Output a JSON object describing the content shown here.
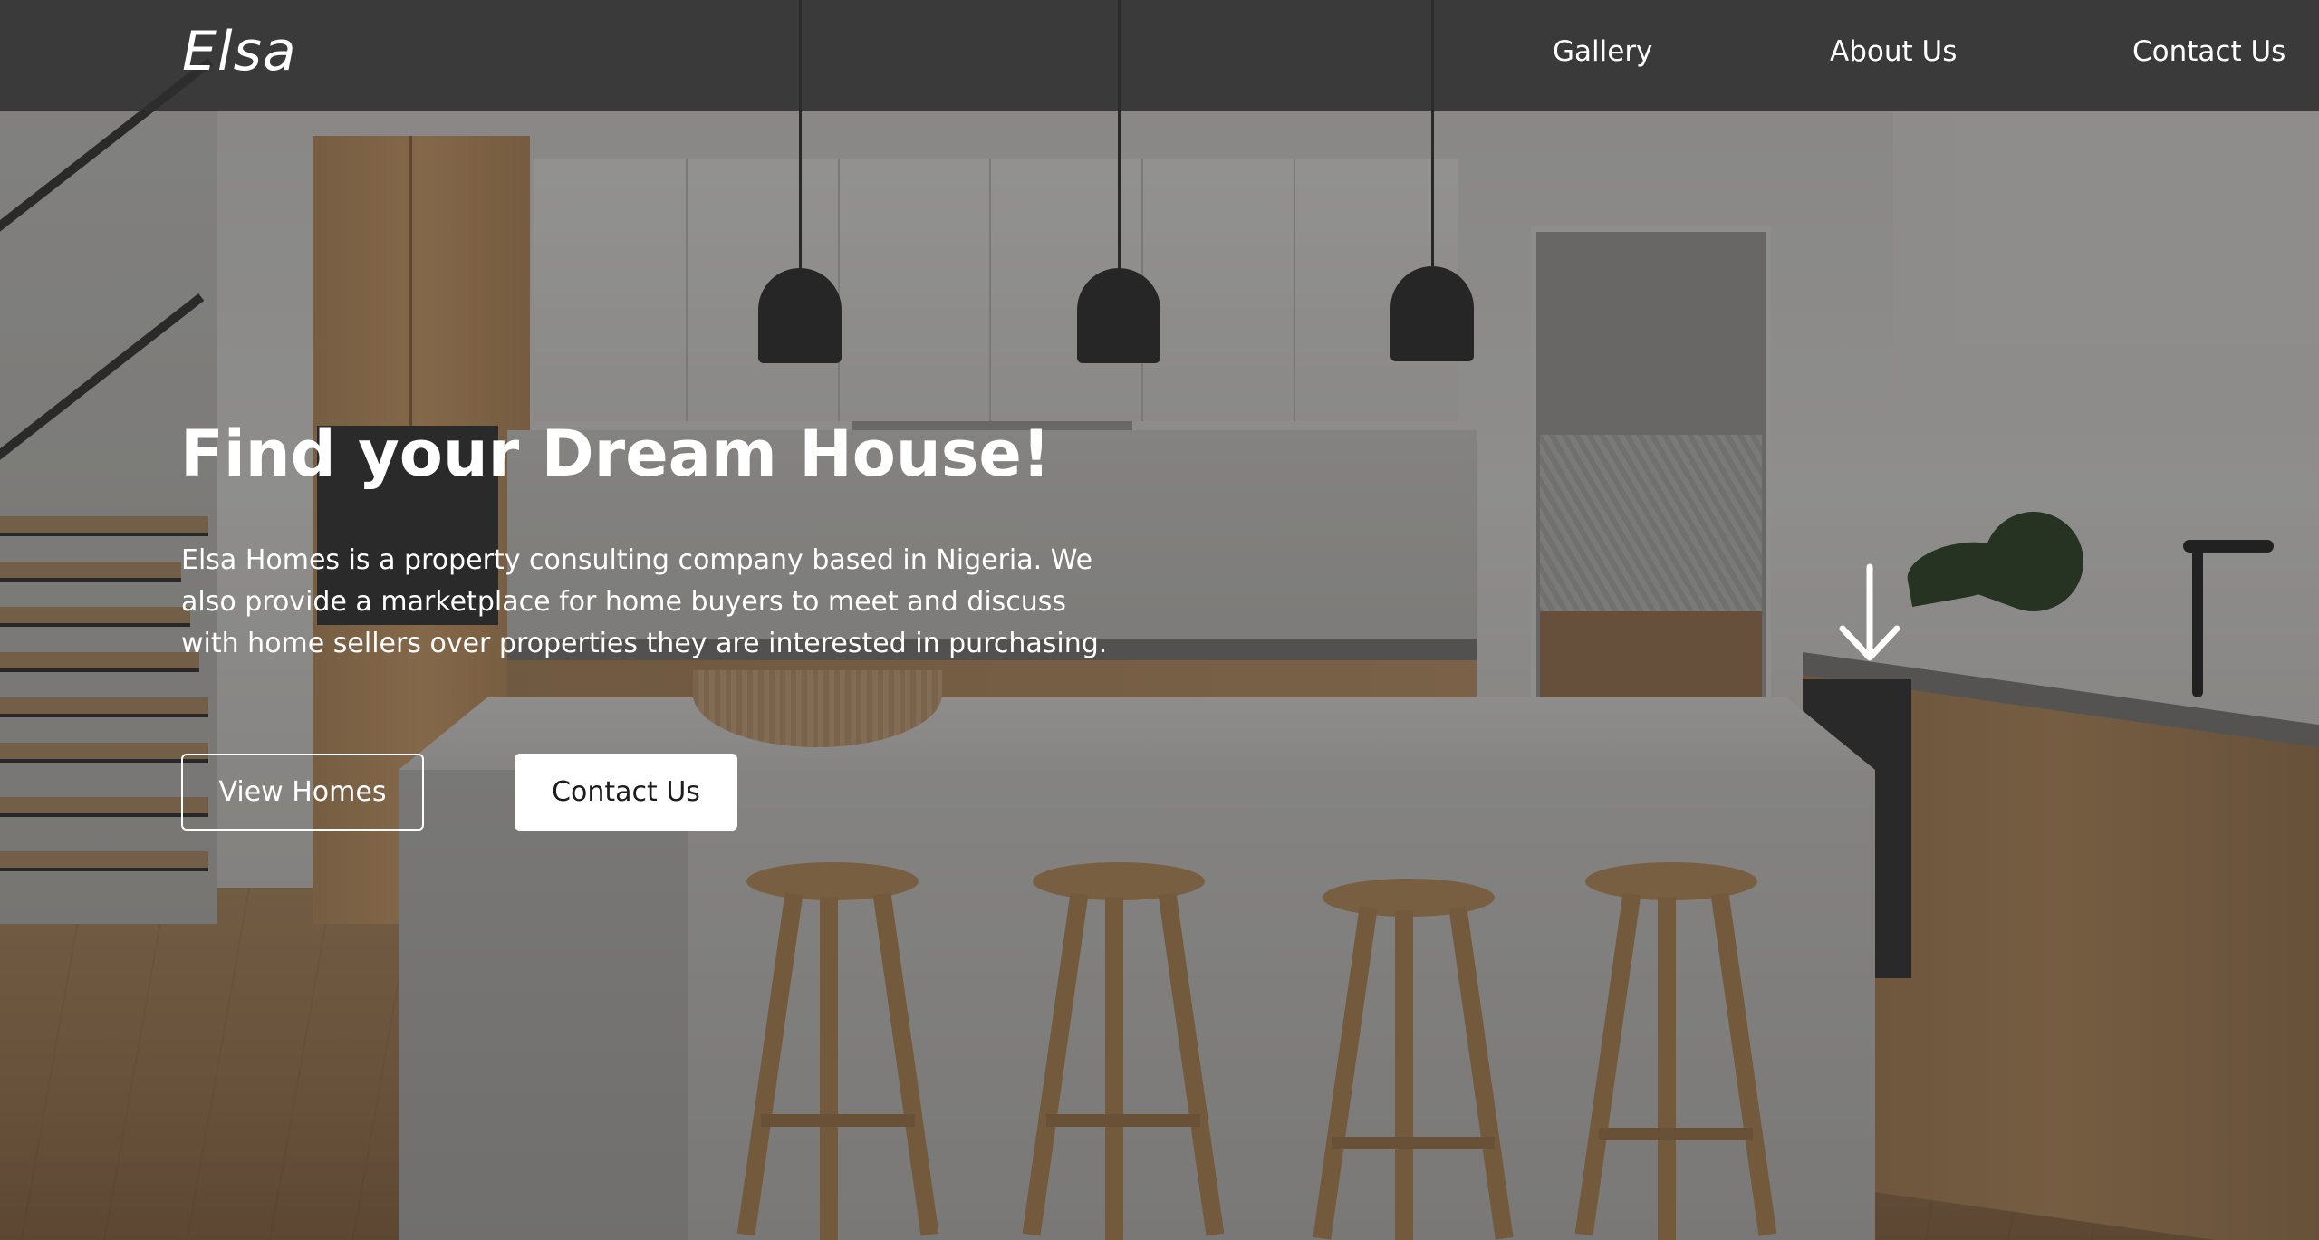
{
  "brand": {
    "logo_text": "Elsa"
  },
  "nav": {
    "items": [
      {
        "label": "Gallery"
      },
      {
        "label": "About Us"
      },
      {
        "label": "Contact Us"
      }
    ]
  },
  "hero": {
    "title": "Find your Dream House!",
    "description": "Elsa Homes is a property consulting company based in Nigeria. We also provide a marketplace for home buyers to meet and discuss with home sellers over properties they are interested in purchasing.",
    "primary_button": "View Homes",
    "secondary_button": "Contact Us",
    "scroll_icon": "arrow-down-icon"
  },
  "colors": {
    "header_bg": "#2d2d2d",
    "text": "#ffffff",
    "button_solid_bg": "#ffffff",
    "button_solid_text": "#1c1c1c"
  }
}
